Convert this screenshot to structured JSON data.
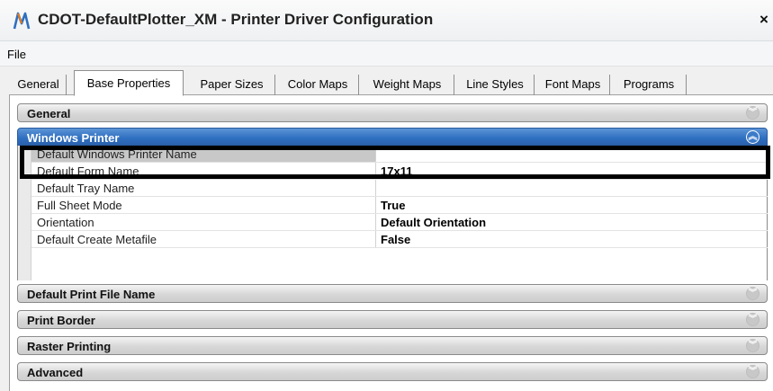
{
  "window": {
    "title": "CDOT-DefaultPlotter_XM - Printer Driver Configuration",
    "close_glyph": "×",
    "app_icon": "microstation-icon"
  },
  "menu": {
    "items": [
      {
        "label": "File"
      }
    ]
  },
  "tabs": [
    {
      "label": "General",
      "active": false
    },
    {
      "label": "Base Properties",
      "active": true
    },
    {
      "label": "Paper Sizes",
      "active": false
    },
    {
      "label": "Color Maps",
      "active": false
    },
    {
      "label": "Weight Maps",
      "active": false
    },
    {
      "label": "Line Styles",
      "active": false
    },
    {
      "label": "Font Maps",
      "active": false
    },
    {
      "label": "Programs",
      "active": false
    }
  ],
  "sections": {
    "general": {
      "label": "General",
      "expanded": false,
      "chevron": "︾"
    },
    "windows_printer": {
      "label": "Windows Printer",
      "expanded": true,
      "chevron": "︽",
      "properties": [
        {
          "name": "Default Windows Printer Name",
          "value": "",
          "selected": true
        },
        {
          "name": "Default Form Name",
          "value": "17x11"
        },
        {
          "name": "Default Tray Name",
          "value": ""
        },
        {
          "name": "Full Sheet Mode",
          "value": "True"
        },
        {
          "name": "Orientation",
          "value": "Default Orientation"
        },
        {
          "name": "Default Create Metafile",
          "value": "False"
        }
      ]
    },
    "default_print_file_name": {
      "label": "Default Print File Name",
      "expanded": false,
      "chevron": "︾"
    },
    "print_border": {
      "label": "Print Border",
      "expanded": false,
      "chevron": "︾"
    },
    "raster_printing": {
      "label": "Raster Printing",
      "expanded": false,
      "chevron": "︾"
    },
    "advanced": {
      "label": "Advanced",
      "expanded": false,
      "chevron": "︾"
    }
  },
  "colors": {
    "accent": "#2f6fc0",
    "header_gray": "#d7d7d7",
    "highlight": "#000000"
  }
}
